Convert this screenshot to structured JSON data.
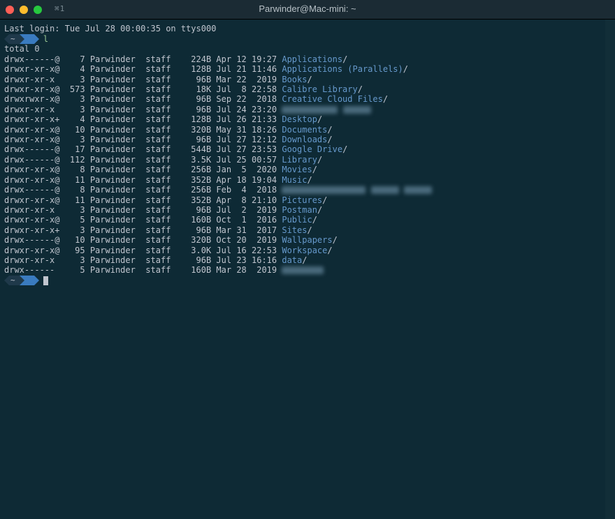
{
  "window": {
    "shortcut": "⌘1",
    "title": "Parwinder@Mac-mini: ~"
  },
  "login_line": "Last login: Tue Jul 28 00:00:35 on ttys000",
  "prompt": {
    "home": "~",
    "command": "l"
  },
  "total_line": "total 0",
  "rows": [
    {
      "perm": "drwx------@",
      "links": "7",
      "owner": "Parwinder",
      "group": "staff",
      "size": "224B",
      "date": "Apr 12 19:27",
      "name": "Applications",
      "blur": false
    },
    {
      "perm": "drwxr-xr-x@",
      "links": "4",
      "owner": "Parwinder",
      "group": "staff",
      "size": "128B",
      "date": "Jul 21 11:46",
      "name": "Applications (Parallels)",
      "blur": false
    },
    {
      "perm": "drwxr-xr-x",
      "links": "3",
      "owner": "Parwinder",
      "group": "staff",
      "size": "96B",
      "date": "Mar 22  2019",
      "name": "Books",
      "blur": false
    },
    {
      "perm": "drwxr-xr-x@",
      "links": "573",
      "owner": "Parwinder",
      "group": "staff",
      "size": "18K",
      "date": "Jul  8 22:58",
      "name": "Calibre Library",
      "blur": false
    },
    {
      "perm": "drwxrwxr-x@",
      "links": "3",
      "owner": "Parwinder",
      "group": "staff",
      "size": "96B",
      "date": "Sep 22  2018",
      "name": "Creative Cloud Files",
      "blur": false
    },
    {
      "perm": "drwxr-xr-x",
      "links": "3",
      "owner": "Parwinder",
      "group": "staff",
      "size": "96B",
      "date": "Jul 24 23:20",
      "name": "",
      "blur": true,
      "blurClass": "w1"
    },
    {
      "perm": "drwxr-xr-x+",
      "links": "4",
      "owner": "Parwinder",
      "group": "staff",
      "size": "128B",
      "date": "Jul 26 21:33",
      "name": "Desktop",
      "blur": false
    },
    {
      "perm": "drwxr-xr-x@",
      "links": "10",
      "owner": "Parwinder",
      "group": "staff",
      "size": "320B",
      "date": "May 31 18:26",
      "name": "Documents",
      "blur": false
    },
    {
      "perm": "drwxr-xr-x@",
      "links": "3",
      "owner": "Parwinder",
      "group": "staff",
      "size": "96B",
      "date": "Jul 27 12:12",
      "name": "Downloads",
      "blur": false
    },
    {
      "perm": "drwx------@",
      "links": "17",
      "owner": "Parwinder",
      "group": "staff",
      "size": "544B",
      "date": "Jul 27 23:53",
      "name": "Google Drive",
      "blur": false
    },
    {
      "perm": "drwx------@",
      "links": "112",
      "owner": "Parwinder",
      "group": "staff",
      "size": "3.5K",
      "date": "Jul 25 00:57",
      "name": "Library",
      "blur": false
    },
    {
      "perm": "drwxr-xr-x@",
      "links": "8",
      "owner": "Parwinder",
      "group": "staff",
      "size": "256B",
      "date": "Jan  5  2020",
      "name": "Movies",
      "blur": false
    },
    {
      "perm": "drwxr-xr-x@",
      "links": "11",
      "owner": "Parwinder",
      "group": "staff",
      "size": "352B",
      "date": "Apr 18 19:04",
      "name": "Music",
      "blur": false
    },
    {
      "perm": "drwx------@",
      "links": "8",
      "owner": "Parwinder",
      "group": "staff",
      "size": "256B",
      "date": "Feb  4  2018",
      "name": "",
      "blur": true,
      "blurClass": "w3"
    },
    {
      "perm": "drwxr-xr-x@",
      "links": "11",
      "owner": "Parwinder",
      "group": "staff",
      "size": "352B",
      "date": "Apr  8 21:10",
      "name": "Pictures",
      "blur": false
    },
    {
      "perm": "drwxr-xr-x",
      "links": "3",
      "owner": "Parwinder",
      "group": "staff",
      "size": "96B",
      "date": "Jul  2  2019",
      "name": "Postman",
      "blur": false
    },
    {
      "perm": "drwxr-xr-x@",
      "links": "5",
      "owner": "Parwinder",
      "group": "staff",
      "size": "160B",
      "date": "Oct  1  2016",
      "name": "Public",
      "blur": false
    },
    {
      "perm": "drwxr-xr-x+",
      "links": "3",
      "owner": "Parwinder",
      "group": "staff",
      "size": "96B",
      "date": "Mar 31  2017",
      "name": "Sites",
      "blur": false
    },
    {
      "perm": "drwx------@",
      "links": "10",
      "owner": "Parwinder",
      "group": "staff",
      "size": "320B",
      "date": "Oct 20  2019",
      "name": "Wallpapers",
      "blur": false
    },
    {
      "perm": "drwxr-xr-x@",
      "links": "95",
      "owner": "Parwinder",
      "group": "staff",
      "size": "3.0K",
      "date": "Jul 16 22:53",
      "name": "Workspace",
      "blur": false
    },
    {
      "perm": "drwxr-xr-x",
      "links": "3",
      "owner": "Parwinder",
      "group": "staff",
      "size": "96B",
      "date": "Jul 23 16:16",
      "name": "data",
      "blur": false
    },
    {
      "perm": "drwx------",
      "links": "5",
      "owner": "Parwinder",
      "group": "staff",
      "size": "160B",
      "date": "Mar 28  2019",
      "name": "",
      "blur": true,
      "blurClass": "w4"
    }
  ]
}
